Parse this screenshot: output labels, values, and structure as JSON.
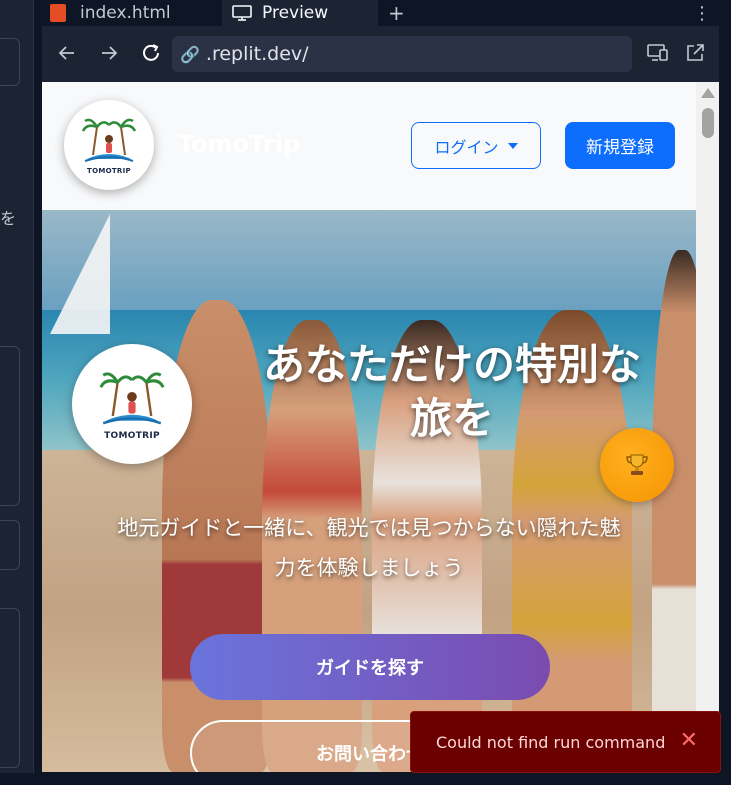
{
  "ide": {
    "tabs": [
      {
        "label": "index.html",
        "icon": "html-file-icon"
      },
      {
        "label": "Preview",
        "icon": "monitor-icon"
      }
    ],
    "add_tab": "+",
    "more": "⋮",
    "left_panel_glyphs": [
      "を"
    ]
  },
  "browser": {
    "url": ".replit.dev/",
    "icons": [
      "back-arrow-icon",
      "forward-arrow-icon",
      "reload-icon",
      "link-icon",
      "devices-icon",
      "open-external-icon"
    ]
  },
  "site": {
    "brand": "TomoTrip",
    "logo_text": "TOMOTRIP",
    "login_label": "ログイン",
    "signup_label": "新規登録",
    "hero": {
      "title_line1": "あなただけの特別な",
      "title_line2": "旅を",
      "subtitle_line1": "地元ガイドと一緒に、観光では見つからない隠れた魅",
      "subtitle_line2": "力を体験しましょう",
      "primary_cta": "ガイドを探す",
      "secondary_cta": "お問い合わせ"
    },
    "colors": {
      "primary": "#0d6efd",
      "cta_gradient_start": "#6a74dc",
      "cta_gradient_end": "#7a4bb0",
      "trophy_badge": "#f59300"
    }
  },
  "toast": {
    "message": "Could not find run command",
    "close": "✕",
    "color": "#6b0000"
  }
}
